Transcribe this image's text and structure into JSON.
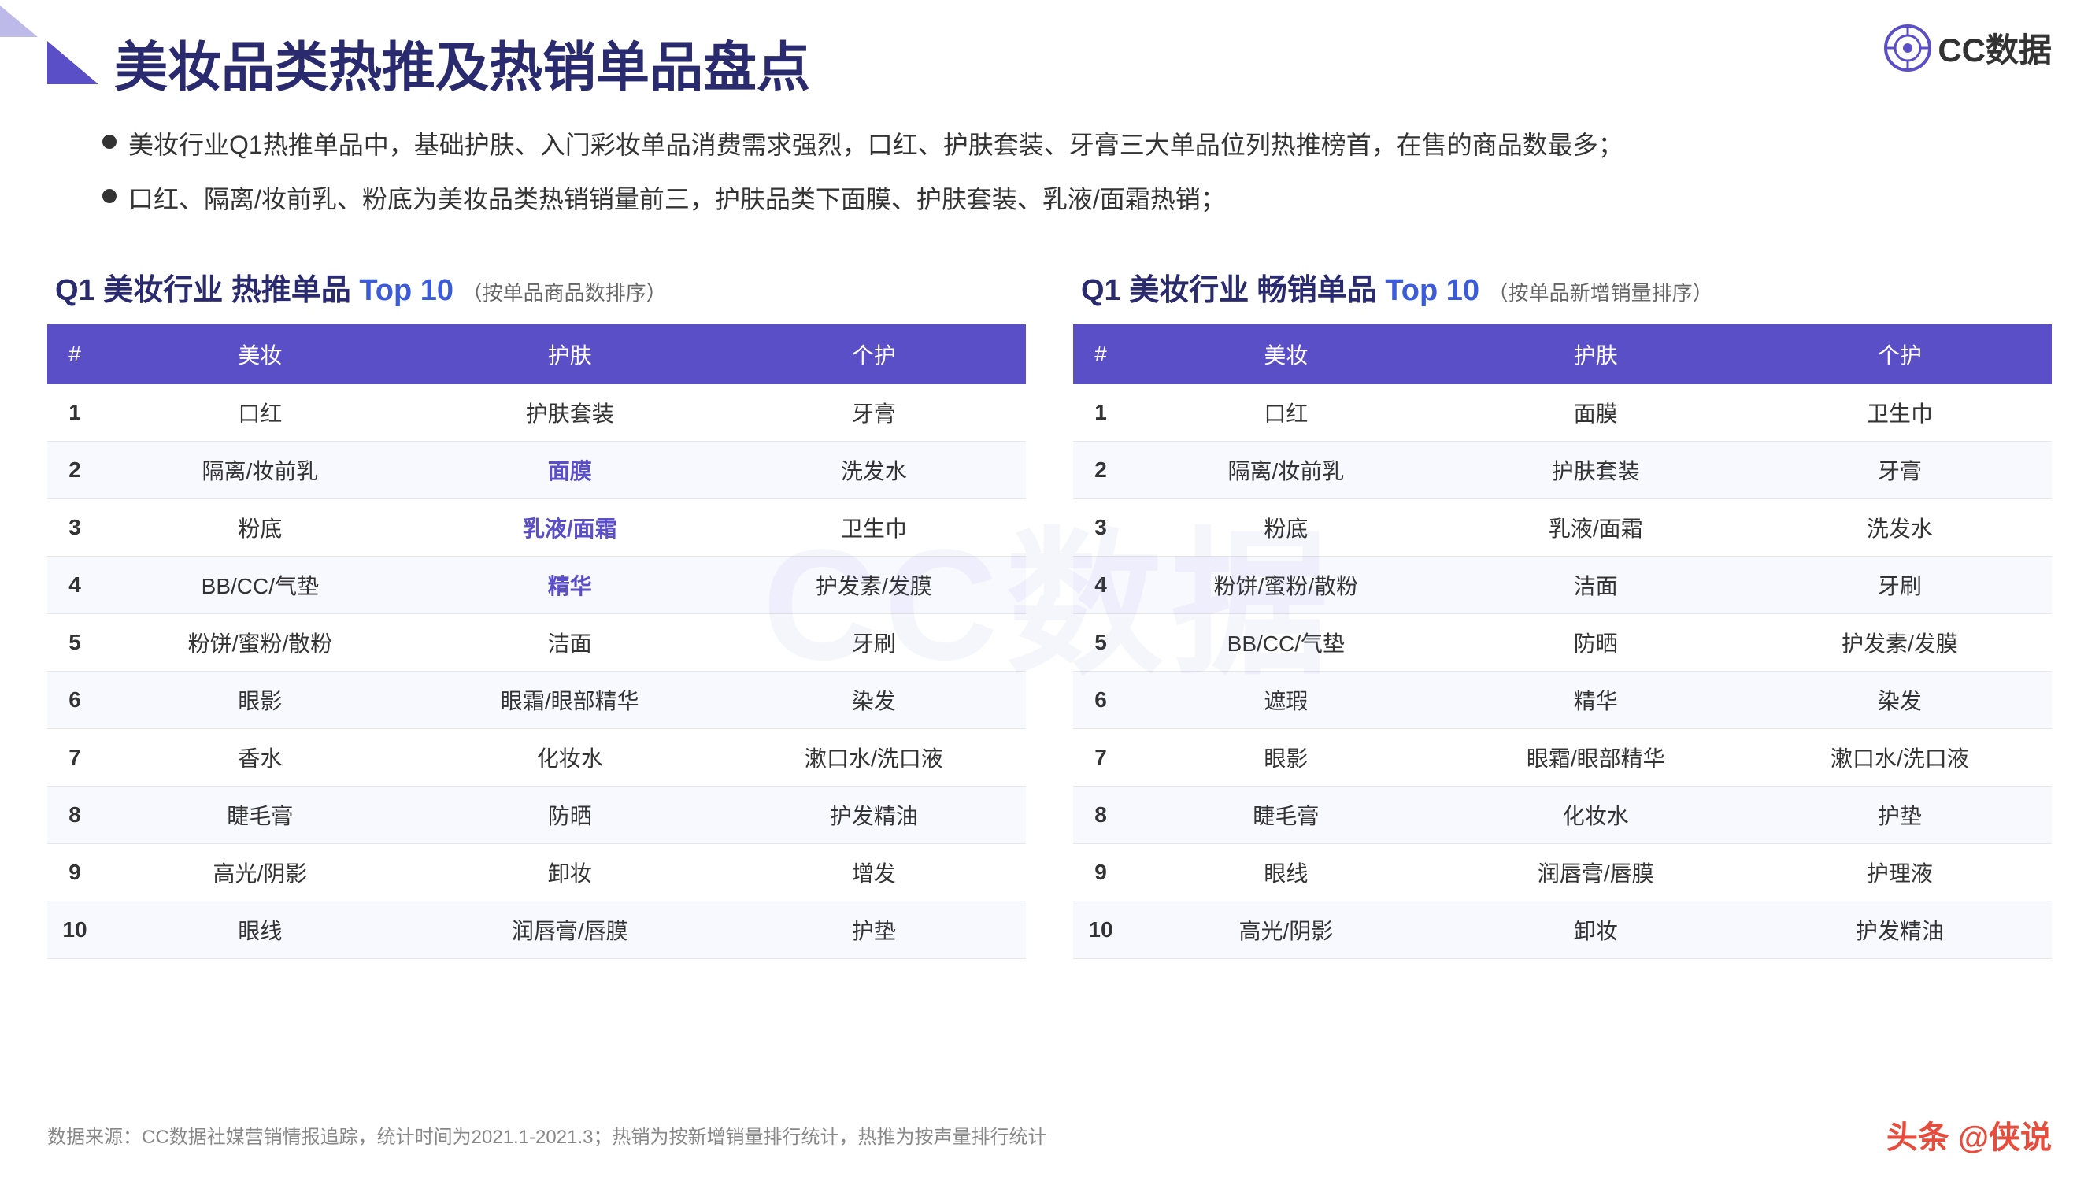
{
  "logo": {
    "text": "CC数据"
  },
  "header": {
    "title": "美妆品类热推及热销单品盘点"
  },
  "bullets": [
    "美妆行业Q1热推单品中，基础护肤、入门彩妆单品消费需求强烈，口红、护肤套装、牙膏三大单品位列热推榜首，在售的商品数最多；",
    "口红、隔离/妆前乳、粉底为美妆品类热销销量前三，护肤品类下面膜、护肤套装、乳液/面霜热销；"
  ],
  "table1": {
    "title": "Q1 美妆行业 热推单品 Top 10",
    "subtitle": "（按单品商品数排序）",
    "headers": [
      "#",
      "美妆",
      "护肤",
      "个护"
    ],
    "rows": [
      {
        "rank": "1",
        "col1": "口红",
        "col2": "护肤套装",
        "col3": "牙膏",
        "h1": false,
        "h2": false,
        "h3": false
      },
      {
        "rank": "2",
        "col1": "隔离/妆前乳",
        "col2": "面膜",
        "col3": "洗发水",
        "h1": false,
        "h2": true,
        "h3": false
      },
      {
        "rank": "3",
        "col1": "粉底",
        "col2": "乳液/面霜",
        "col3": "卫生巾",
        "h1": false,
        "h2": true,
        "h3": false
      },
      {
        "rank": "4",
        "col1": "BB/CC/气垫",
        "col2": "精华",
        "col3": "护发素/发膜",
        "h1": false,
        "h2": true,
        "h3": false
      },
      {
        "rank": "5",
        "col1": "粉饼/蜜粉/散粉",
        "col2": "洁面",
        "col3": "牙刷",
        "h1": false,
        "h2": false,
        "h3": false
      },
      {
        "rank": "6",
        "col1": "眼影",
        "col2": "眼霜/眼部精华",
        "col3": "染发",
        "h1": false,
        "h2": false,
        "h3": false
      },
      {
        "rank": "7",
        "col1": "香水",
        "col2": "化妆水",
        "col3": "漱口水/洗口液",
        "h1": false,
        "h2": false,
        "h3": false
      },
      {
        "rank": "8",
        "col1": "睫毛膏",
        "col2": "防晒",
        "col3": "护发精油",
        "h1": false,
        "h2": false,
        "h3": false
      },
      {
        "rank": "9",
        "col1": "高光/阴影",
        "col2": "卸妆",
        "col3": "增发",
        "h1": false,
        "h2": false,
        "h3": false
      },
      {
        "rank": "10",
        "col1": "眼线",
        "col2": "润唇膏/唇膜",
        "col3": "护垫",
        "h1": false,
        "h2": false,
        "h3": false
      }
    ]
  },
  "table2": {
    "title": "Q1 美妆行业 畅销单品 Top 10",
    "subtitle": "（按单品新增销量排序）",
    "headers": [
      "#",
      "美妆",
      "护肤",
      "个护"
    ],
    "rows": [
      {
        "rank": "1",
        "col1": "口红",
        "col2": "面膜",
        "col3": "卫生巾",
        "h1": false,
        "h2": false,
        "h3": false
      },
      {
        "rank": "2",
        "col1": "隔离/妆前乳",
        "col2": "护肤套装",
        "col3": "牙膏",
        "h1": false,
        "h2": false,
        "h3": false
      },
      {
        "rank": "3",
        "col1": "粉底",
        "col2": "乳液/面霜",
        "col3": "洗发水",
        "h1": false,
        "h2": false,
        "h3": false
      },
      {
        "rank": "4",
        "col1": "粉饼/蜜粉/散粉",
        "col2": "洁面",
        "col3": "牙刷",
        "h1": false,
        "h2": false,
        "h3": false
      },
      {
        "rank": "5",
        "col1": "BB/CC/气垫",
        "col2": "防晒",
        "col3": "护发素/发膜",
        "h1": false,
        "h2": false,
        "h3": false
      },
      {
        "rank": "6",
        "col1": "遮瑕",
        "col2": "精华",
        "col3": "染发",
        "h1": false,
        "h2": false,
        "h3": false
      },
      {
        "rank": "7",
        "col1": "眼影",
        "col2": "眼霜/眼部精华",
        "col3": "漱口水/洗口液",
        "h1": false,
        "h2": false,
        "h3": false
      },
      {
        "rank": "8",
        "col1": "睫毛膏",
        "col2": "化妆水",
        "col3": "护垫",
        "h1": false,
        "h2": false,
        "h3": false
      },
      {
        "rank": "9",
        "col1": "眼线",
        "col2": "润唇膏/唇膜",
        "col3": "护理液",
        "h1": false,
        "h2": false,
        "h3": false
      },
      {
        "rank": "10",
        "col1": "高光/阴影",
        "col2": "卸妆",
        "col3": "护发精油",
        "h1": false,
        "h2": false,
        "h3": false
      }
    ]
  },
  "footer": {
    "source": "数据来源：CC数据社媒营销情报追踪，统计时间为2021.1-2021.3；热销为按新增销量排行统计，热推为按声量排行统计",
    "brand": "头条 @侠说"
  },
  "watermark": "CC数据"
}
